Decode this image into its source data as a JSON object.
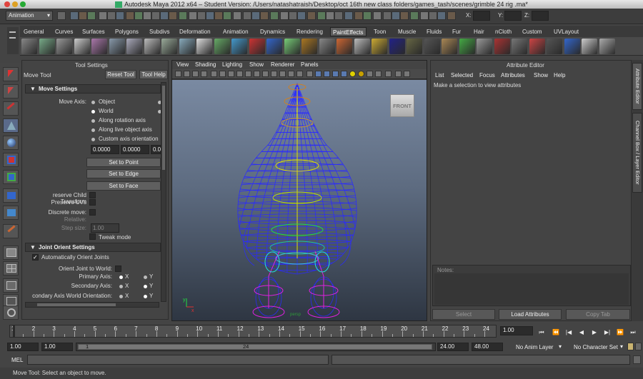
{
  "window": {
    "title": "Autodesk Maya 2012 x64 – Student Version: /Users/natashatraish/Desktop/oct 16th new class folders/games_tash/scenes/grimble 24 rig .ma*"
  },
  "status_line": {
    "menu_set": "Animation",
    "x_label": "X:",
    "y_label": "Y:",
    "z_label": "Z:"
  },
  "shelf_tabs": [
    "General",
    "Curves",
    "Surfaces",
    "Polygons",
    "Subdivs",
    "Deformation",
    "Animation",
    "Dynamics",
    "Rendering",
    "PaintEffects",
    "Toon",
    "Muscle",
    "Fluids",
    "Fur",
    "Hair",
    "nCloth",
    "Custom",
    "UVLayout"
  ],
  "shelf_active": "PaintEffects",
  "tool_settings": {
    "header": "Tool Settings",
    "tool_name": "Move Tool",
    "reset_label": "Reset Tool",
    "help_label": "Tool Help",
    "move_settings": {
      "title": "Move Settings",
      "move_axis_label": "Move Axis:",
      "options": [
        "Object",
        "World",
        "Along rotation axis",
        "Along live object axis",
        "Custom axis orientation"
      ],
      "selected": "World",
      "custom_values": [
        "0.0000",
        "0.0000",
        "0.0"
      ],
      "set_to_point": "Set to Point",
      "set_to_edge": "Set to Edge",
      "set_to_face": "Set to Face",
      "preserve_child": "reserve Child Transform",
      "preserve_uvs": "Preserve UVs",
      "discrete_move": "Discrete move:",
      "relative": "Relative:",
      "step_size_label": "Step size:",
      "step_size_value": "1.00",
      "tweak_mode": "Tweak mode"
    },
    "joint_orient": {
      "title": "Joint Orient Settings",
      "auto_orient": "Automatically Orient Joints",
      "orient_world": "Orient Joint to World:",
      "primary_axis": "Primary Axis:",
      "secondary_axis": "Secondary Axis:",
      "secondary_world": "condary Axis World Orientation:",
      "x": "X",
      "y": "Y"
    }
  },
  "viewport": {
    "menus": [
      "View",
      "Shading",
      "Lighting",
      "Show",
      "Renderer",
      "Panels"
    ],
    "view_cube_label": "FRONT",
    "camera_label": "persp"
  },
  "attribute_editor": {
    "header": "Attribute Editor",
    "menus": [
      "List",
      "Selected",
      "Focus",
      "Attributes",
      "Show",
      "Help"
    ],
    "message": "Make a selection to view attributes",
    "notes_label": "Notes:",
    "select_btn": "Select",
    "load_btn": "Load Attributes",
    "copy_btn": "Copy Tab"
  },
  "right_tabs": [
    "Attribute Editor",
    "Channel Box / Layer Editor"
  ],
  "timeline": {
    "ticks": [
      "1",
      "2",
      "3",
      "4",
      "5",
      "6",
      "7",
      "8",
      "9",
      "10",
      "11",
      "12",
      "13",
      "14",
      "15",
      "16",
      "17",
      "18",
      "19",
      "20",
      "21",
      "22",
      "23",
      "24"
    ],
    "current_time": "1.00"
  },
  "range": {
    "start": "1.00",
    "inner_start": "1.00",
    "slider_start": "1",
    "slider_end": "24",
    "end": "24.00",
    "outer_end": "48.00",
    "anim_layer": "No Anim Layer",
    "character_set": "No Character Set"
  },
  "command_line": {
    "label": "MEL"
  },
  "help_line": {
    "text": "Move Tool: Select an object to move."
  },
  "colors": {
    "wire": "#2a2aff",
    "joint_yellow": "#e0e000",
    "joint_green": "#20e040",
    "joint_magenta": "#e020e0",
    "accent_orange": "#d08020"
  }
}
